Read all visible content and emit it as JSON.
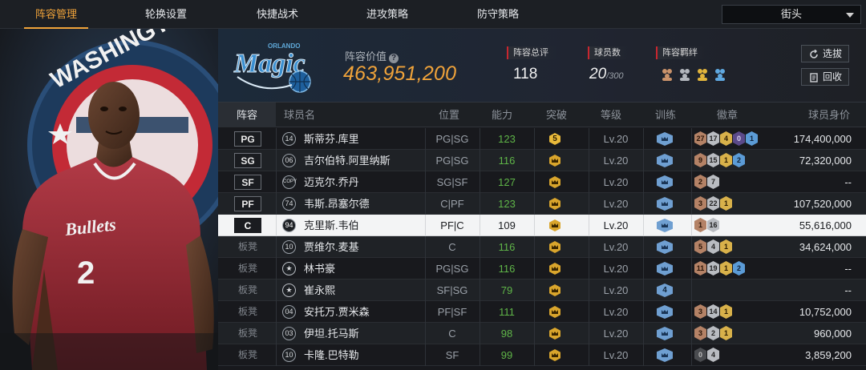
{
  "nav": {
    "tabs": [
      {
        "label": "阵容管理",
        "active": true
      },
      {
        "label": "轮换设置",
        "active": false
      },
      {
        "label": "快捷战术",
        "active": false
      },
      {
        "label": "进攻策略",
        "active": false
      },
      {
        "label": "防守策略",
        "active": false
      }
    ],
    "mode_select": "街头"
  },
  "team": {
    "logo_icon": "orlando-magic-logo",
    "value_label": "阵容价值",
    "value": "463,951,200",
    "rating_label": "阵容总评",
    "rating": "118",
    "player_count_label": "球员数",
    "player_count": "20",
    "player_count_max": "/300",
    "bond_label": "阵容羁绊",
    "buttons": {
      "scout": "选拔",
      "recycle": "回收"
    }
  },
  "table": {
    "headers": [
      "阵容",
      "球员名",
      "位置",
      "能力",
      "突破",
      "等级",
      "训练",
      "徽章",
      "球员身价"
    ],
    "rows": [
      {
        "slot": "PG",
        "jersey": "14",
        "name": "斯蒂芬.库里",
        "position": "PG|SG",
        "ability": "123",
        "breakthrough": "5",
        "level": "Lv.20",
        "training": "",
        "badges": [
          "27",
          "17",
          "4",
          "0",
          "1"
        ],
        "badge_colors": [
          "bronze",
          "silver",
          "gold",
          "purple",
          "blue"
        ],
        "value": "174,400,000",
        "starter": true,
        "selected": false
      },
      {
        "slot": "SG",
        "jersey": "06",
        "name": "吉尔伯特.阿里纳斯",
        "position": "PG|SG",
        "ability": "116",
        "breakthrough": "crown",
        "level": "Lv.20",
        "training": "",
        "badges": [
          "9",
          "15",
          "1",
          "2"
        ],
        "badge_colors": [
          "bronze",
          "silver",
          "gold",
          "blue"
        ],
        "value": "72,320,000",
        "starter": true,
        "selected": false
      },
      {
        "slot": "SF",
        "jersey": "COPY",
        "name": "迈克尔.乔丹",
        "position": "SG|SF",
        "ability": "127",
        "breakthrough": "crown",
        "level": "Lv.20",
        "training": "",
        "badges": [
          "2",
          "7"
        ],
        "badge_colors": [
          "bronze",
          "silver"
        ],
        "value": "--",
        "starter": true,
        "selected": false
      },
      {
        "slot": "PF",
        "jersey": "74",
        "name": "韦斯.昂塞尔德",
        "position": "C|PF",
        "ability": "123",
        "breakthrough": "crown",
        "level": "Lv.20",
        "training": "",
        "badges": [
          "3",
          "22",
          "1"
        ],
        "badge_colors": [
          "bronze",
          "silver",
          "gold"
        ],
        "value": "107,520,000",
        "starter": true,
        "selected": false
      },
      {
        "slot": "C",
        "jersey": "94",
        "name": "克里斯.韦伯",
        "position": "PF|C",
        "ability": "109",
        "breakthrough": "crown",
        "level": "Lv.20",
        "training": "",
        "badges": [
          "1",
          "16"
        ],
        "badge_colors": [
          "bronze",
          "silver"
        ],
        "value": "55,616,000",
        "starter": true,
        "selected": true
      },
      {
        "slot": "板凳",
        "jersey": "10",
        "name": "贾维尔.麦基",
        "position": "C",
        "ability": "116",
        "breakthrough": "crown",
        "level": "Lv.20",
        "training": "",
        "badges": [
          "5",
          "4",
          "1"
        ],
        "badge_colors": [
          "bronze",
          "silver",
          "gold"
        ],
        "value": "34,624,000",
        "starter": false,
        "selected": false
      },
      {
        "slot": "板凳",
        "jersey": "★",
        "name": "林书豪",
        "position": "PG|SG",
        "ability": "116",
        "breakthrough": "crown",
        "level": "Lv.20",
        "training": "",
        "badges": [
          "11",
          "19",
          "1",
          "2"
        ],
        "badge_colors": [
          "bronze",
          "silver",
          "gold",
          "blue"
        ],
        "value": "--",
        "starter": false,
        "selected": false
      },
      {
        "slot": "板凳",
        "jersey": "★",
        "name": "崔永熙",
        "position": "SF|SG",
        "ability": "79",
        "breakthrough": "crown",
        "level": "Lv.20",
        "training": "4",
        "badges": [],
        "badge_colors": [],
        "value": "--",
        "starter": false,
        "selected": false
      },
      {
        "slot": "板凳",
        "jersey": "04",
        "name": "安托万.贾米森",
        "position": "PF|SF",
        "ability": "111",
        "breakthrough": "crown",
        "level": "Lv.20",
        "training": "",
        "badges": [
          "3",
          "14",
          "1"
        ],
        "badge_colors": [
          "bronze",
          "silver",
          "gold"
        ],
        "value": "10,752,000",
        "starter": false,
        "selected": false
      },
      {
        "slot": "板凳",
        "jersey": "03",
        "name": "伊坦.托马斯",
        "position": "C",
        "ability": "98",
        "breakthrough": "crown",
        "level": "Lv.20",
        "training": "",
        "badges": [
          "3",
          "2",
          "1"
        ],
        "badge_colors": [
          "bronze",
          "silver",
          "gold"
        ],
        "value": "960,000",
        "starter": false,
        "selected": false
      },
      {
        "slot": "板凳",
        "jersey": "10",
        "name": "卡隆.巴特勒",
        "position": "SF",
        "ability": "99",
        "breakthrough": "crown",
        "level": "Lv.20",
        "training": "",
        "badges": [
          "0",
          "4"
        ],
        "badge_colors": [
          "dark",
          "silver"
        ],
        "value": "3,859,200",
        "starter": false,
        "selected": false
      }
    ]
  },
  "colors": {
    "accent": "#f0a33a",
    "ability_green": "#5fb548",
    "selected_row": "#f3f4f5"
  }
}
